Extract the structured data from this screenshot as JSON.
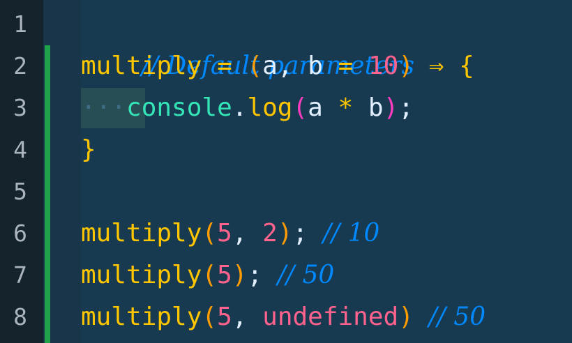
{
  "editor": {
    "line_numbers": [
      "1",
      "2",
      "3",
      "4",
      "5",
      "6",
      "7",
      "8"
    ],
    "line1": {
      "comment": "// Default parameters"
    },
    "line2": {
      "fn": "multiply",
      "sp1": " ",
      "eq": "=",
      "sp2": " ",
      "open": "(",
      "a": "a",
      "comma": ",",
      "sp3": " ",
      "b": "b",
      "sp4": " ",
      "eq2": "=",
      "sp5": " ",
      "ten": "10",
      "close": ")",
      "sp6": " ",
      "arrow": "⇒",
      "sp7": " ",
      "brace": "{"
    },
    "line3": {
      "indent": "···",
      "console": "console",
      "dot": ".",
      "log": "log",
      "open": "(",
      "a": "a",
      "sp1": " ",
      "star": "*",
      "sp2": " ",
      "b": "b",
      "close": ")",
      "semi": ";"
    },
    "line4": {
      "brace": "}"
    },
    "line6": {
      "fn": "multiply",
      "open": "(",
      "five": "5",
      "comma": ",",
      "sp1": " ",
      "two": "2",
      "close": ")",
      "semi": ";",
      "sp2": " ",
      "comment": "// 10"
    },
    "line7": {
      "fn": "multiply",
      "open": "(",
      "five": "5",
      "close": ")",
      "semi": ";",
      "sp1": " ",
      "comment": "// 50"
    },
    "line8": {
      "fn": "multiply",
      "open": "(",
      "five": "5",
      "comma": ",",
      "sp1": " ",
      "undef": "undefined",
      "close": ")",
      "sp2": " ",
      "comment": "// 50"
    }
  },
  "colors": {
    "background": "#193549",
    "comment": "#0088ff",
    "function": "#ffc600",
    "number": "#ff628c",
    "object": "#35e5b8",
    "git_added": "#1ea34b"
  }
}
